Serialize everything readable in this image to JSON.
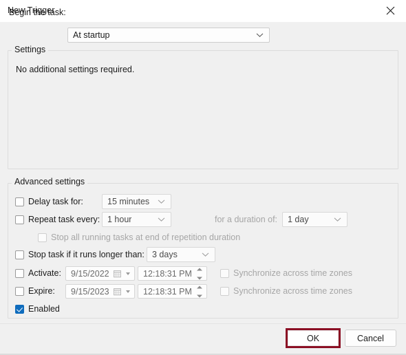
{
  "window": {
    "title": "New Trigger",
    "close_icon": "close-icon"
  },
  "begin": {
    "label": "Begin the task:",
    "value": "At startup",
    "chevron_icon": "chevron-down-icon"
  },
  "settings_group": {
    "legend": "Settings",
    "message": "No additional settings required."
  },
  "advanced_group": {
    "legend": "Advanced settings",
    "delay": {
      "label": "Delay task for:",
      "checked": false,
      "value": "15 minutes"
    },
    "repeat": {
      "label": "Repeat task every:",
      "checked": false,
      "value": "1 hour",
      "duration_label": "for a duration of:",
      "duration_value": "1 day"
    },
    "stop_all": {
      "label": "Stop all running tasks at end of repetition duration",
      "checked": false,
      "disabled": true
    },
    "stop_longer": {
      "label": "Stop task if it runs longer than:",
      "checked": false,
      "value": "3 days"
    },
    "activate": {
      "label": "Activate:",
      "checked": false,
      "date": "9/15/2022",
      "time": "12:18:31 PM",
      "sync_label": "Synchronize across time zones",
      "sync_checked": false
    },
    "expire": {
      "label": "Expire:",
      "checked": false,
      "date": "9/15/2023",
      "time": "12:18:31 PM",
      "sync_label": "Synchronize across time zones",
      "sync_checked": false
    },
    "enabled": {
      "label": "Enabled",
      "checked": true
    }
  },
  "footer": {
    "ok_label": "OK",
    "cancel_label": "Cancel"
  },
  "colors": {
    "accent": "#0f6cbd",
    "highlight_border": "#8b0f24",
    "dialog_bg": "#f0f0f0",
    "titlebar_bg": "#ffffff"
  }
}
